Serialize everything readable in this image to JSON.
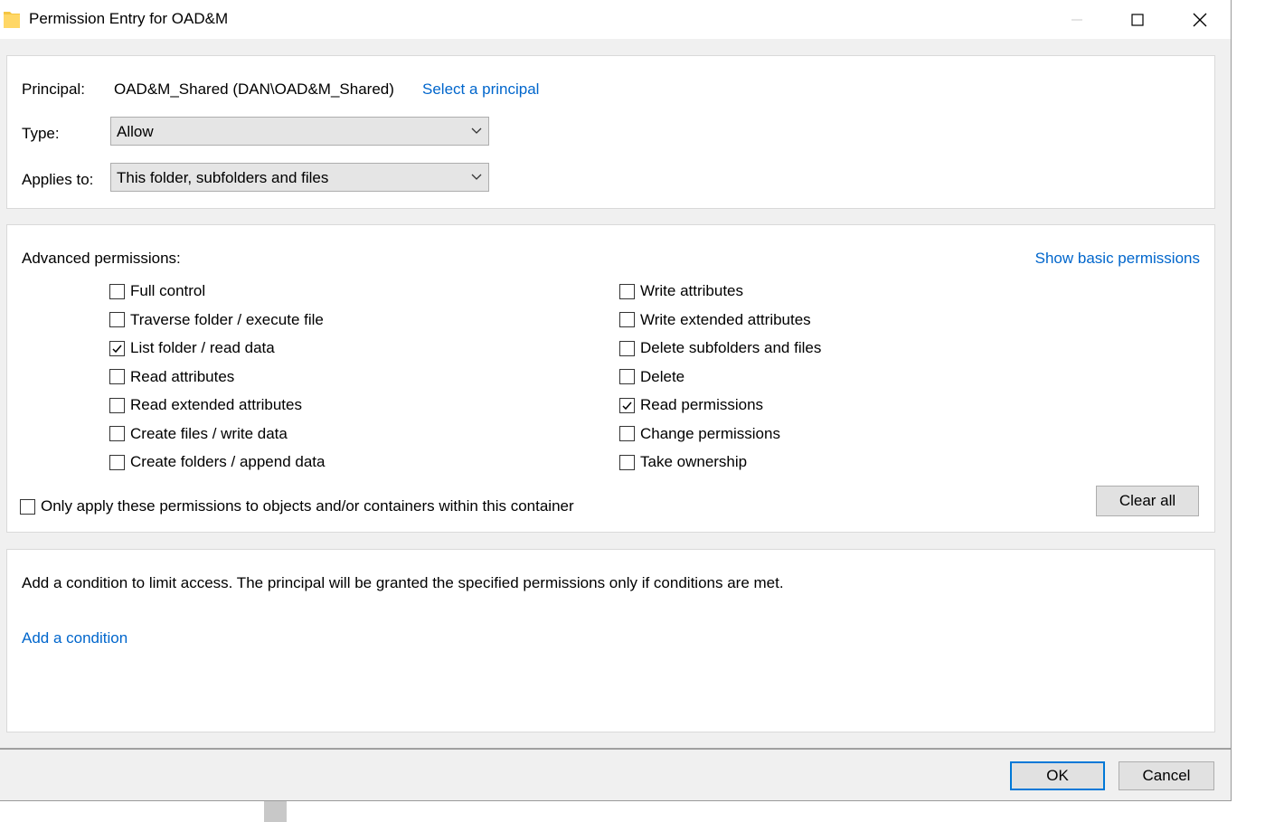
{
  "window": {
    "title": "Permission Entry for OAD&M",
    "folder_color": "#f5c542"
  },
  "principal": {
    "label": "Principal:",
    "value": "OAD&M_Shared (DAN\\OAD&M_Shared)",
    "select_link": "Select a principal"
  },
  "type": {
    "label": "Type:",
    "value": "Allow"
  },
  "applies_to": {
    "label": "Applies to:",
    "value": "This folder, subfolders and files"
  },
  "advanced": {
    "label": "Advanced permissions:",
    "show_basic_link": "Show basic permissions",
    "left_column": [
      {
        "label": "Full control",
        "checked": false
      },
      {
        "label": "Traverse folder / execute file",
        "checked": false
      },
      {
        "label": "List folder / read data",
        "checked": true
      },
      {
        "label": "Read attributes",
        "checked": false
      },
      {
        "label": "Read extended attributes",
        "checked": false
      },
      {
        "label": "Create files / write data",
        "checked": false
      },
      {
        "label": "Create folders / append data",
        "checked": false
      }
    ],
    "right_column": [
      {
        "label": "Write attributes",
        "checked": false
      },
      {
        "label": "Write extended attributes",
        "checked": false
      },
      {
        "label": "Delete subfolders and files",
        "checked": false
      },
      {
        "label": "Delete",
        "checked": false
      },
      {
        "label": "Read permissions",
        "checked": true
      },
      {
        "label": "Change permissions",
        "checked": false
      },
      {
        "label": "Take ownership",
        "checked": false
      }
    ],
    "only_apply": {
      "label": "Only apply these permissions to objects and/or containers within this container",
      "checked": false
    },
    "clear_all": "Clear all"
  },
  "condition": {
    "description": "Add a condition to limit access. The principal will be granted the specified permissions only if conditions are met.",
    "add_link": "Add a condition"
  },
  "footer": {
    "ok": "OK",
    "cancel": "Cancel"
  },
  "colors": {
    "link": "#0066cc",
    "default_button_border": "#0078d7"
  }
}
